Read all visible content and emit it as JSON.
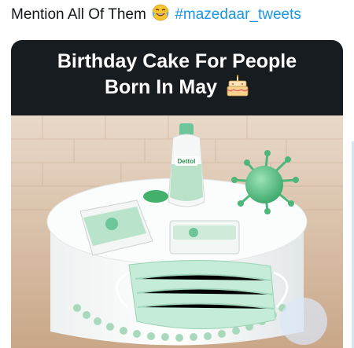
{
  "tweet": {
    "text": "Mention All Of Them",
    "emoji": "face-with-tears-of-joy-icon",
    "hashtag": "#mazedaar_tweets"
  },
  "media": {
    "banner_line1": "Birthday Cake For People",
    "banner_line2": "Born In May",
    "banner_emoji": "birthday-cake-icon",
    "photo_items": [
      "Dettol"
    ]
  },
  "colors": {
    "hashtag": "#1b95e0",
    "banner_bg": "#171c21",
    "cake_teal": "#5cc08a"
  }
}
